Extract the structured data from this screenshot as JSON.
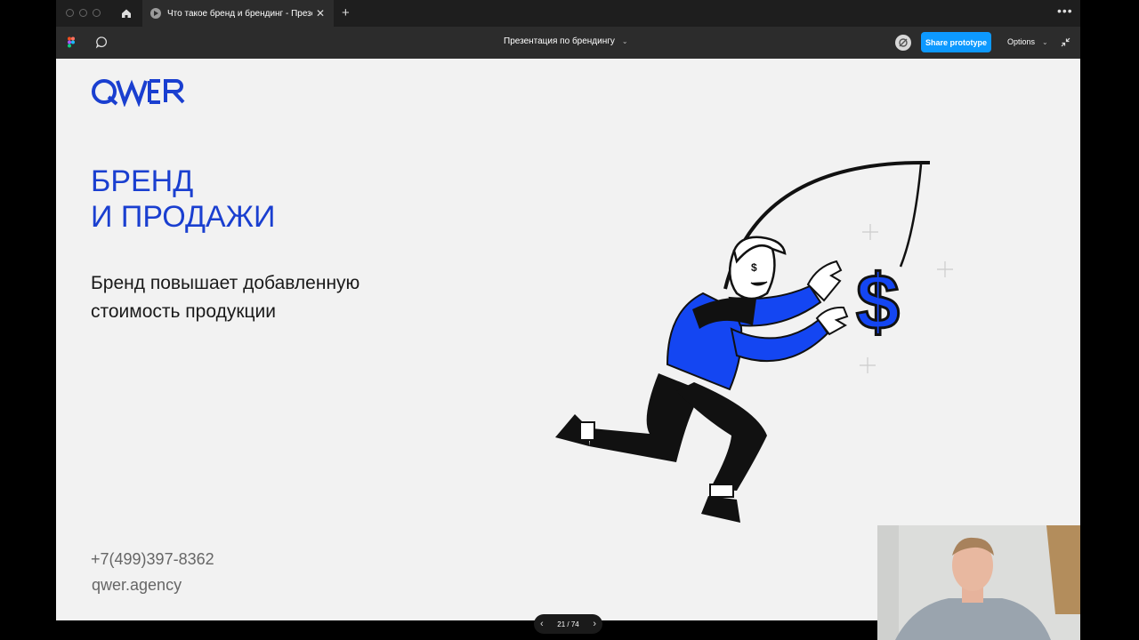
{
  "browser": {
    "tab_title": "Что такое бренд и брендинг - Презентация по брендингу",
    "new_tab_icon": "plus-icon",
    "more_icon": "more-icon"
  },
  "toolbar": {
    "file_title": "Презентация по брендингу",
    "share_label": "Share prototype",
    "options_label": "Options",
    "accent_color": "#0d99ff"
  },
  "slide": {
    "heading_line1": "БРЕНД",
    "heading_line2": "И ПРОДАЖИ",
    "body_text": "Бренд повышает добавленную стоимость продукции",
    "phone": "+7(499)397-8362",
    "website": "qwer.agency",
    "brand_color": "#1a3fd0",
    "logo_text": "QWER"
  },
  "navigation": {
    "counter": "21 / 74"
  }
}
